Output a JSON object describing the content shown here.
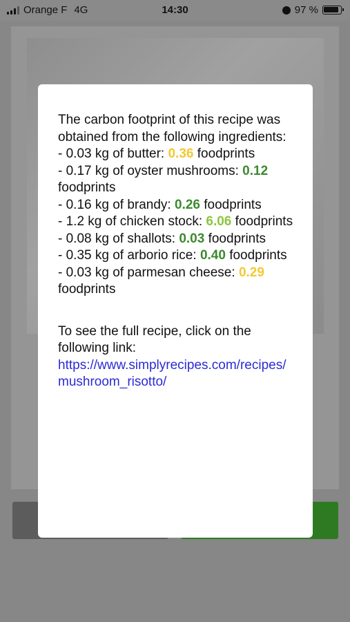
{
  "status_bar": {
    "carrier": "Orange F",
    "network": "4G",
    "time": "14:30",
    "battery": "97 %"
  },
  "modal": {
    "intro": "The carbon footprint of this recipe was obtained from the following ingredients:",
    "ingredients": [
      {
        "prefix": "- 0.03 kg of butter: ",
        "value": "0.36",
        "suffix": " foodprints",
        "color": "#f2c935"
      },
      {
        "prefix": "- 0.17 kg of oyster mushrooms: ",
        "value": "0.12",
        "suffix": " foodprints",
        "color": "#3b8a2e"
      },
      {
        "prefix": "- 0.16 kg of brandy: ",
        "value": "0.26",
        "suffix": " foodprints",
        "color": "#3b8a2e"
      },
      {
        "prefix": "- 1.2 kg of chicken stock: ",
        "value": "6.06",
        "suffix": " foodprints",
        "color": "#8cc63f"
      },
      {
        "prefix": "- 0.08 kg of shallots: ",
        "value": "0.03",
        "suffix": " foodprints",
        "color": "#3b8a2e"
      },
      {
        "prefix": "- 0.35 kg of arborio rice: ",
        "value": "0.40",
        "suffix": " foodprints",
        "color": "#3b8a2e"
      },
      {
        "prefix": "- 0.03 kg of parmesan cheese: ",
        "value": "0.29",
        "suffix": " foodprints",
        "color": "#f2c935"
      }
    ],
    "see_full": "To see the full recipe, click on the following link:",
    "link": "https://www.simplyrecipes.com/recipes/mushroom_risotto/"
  }
}
